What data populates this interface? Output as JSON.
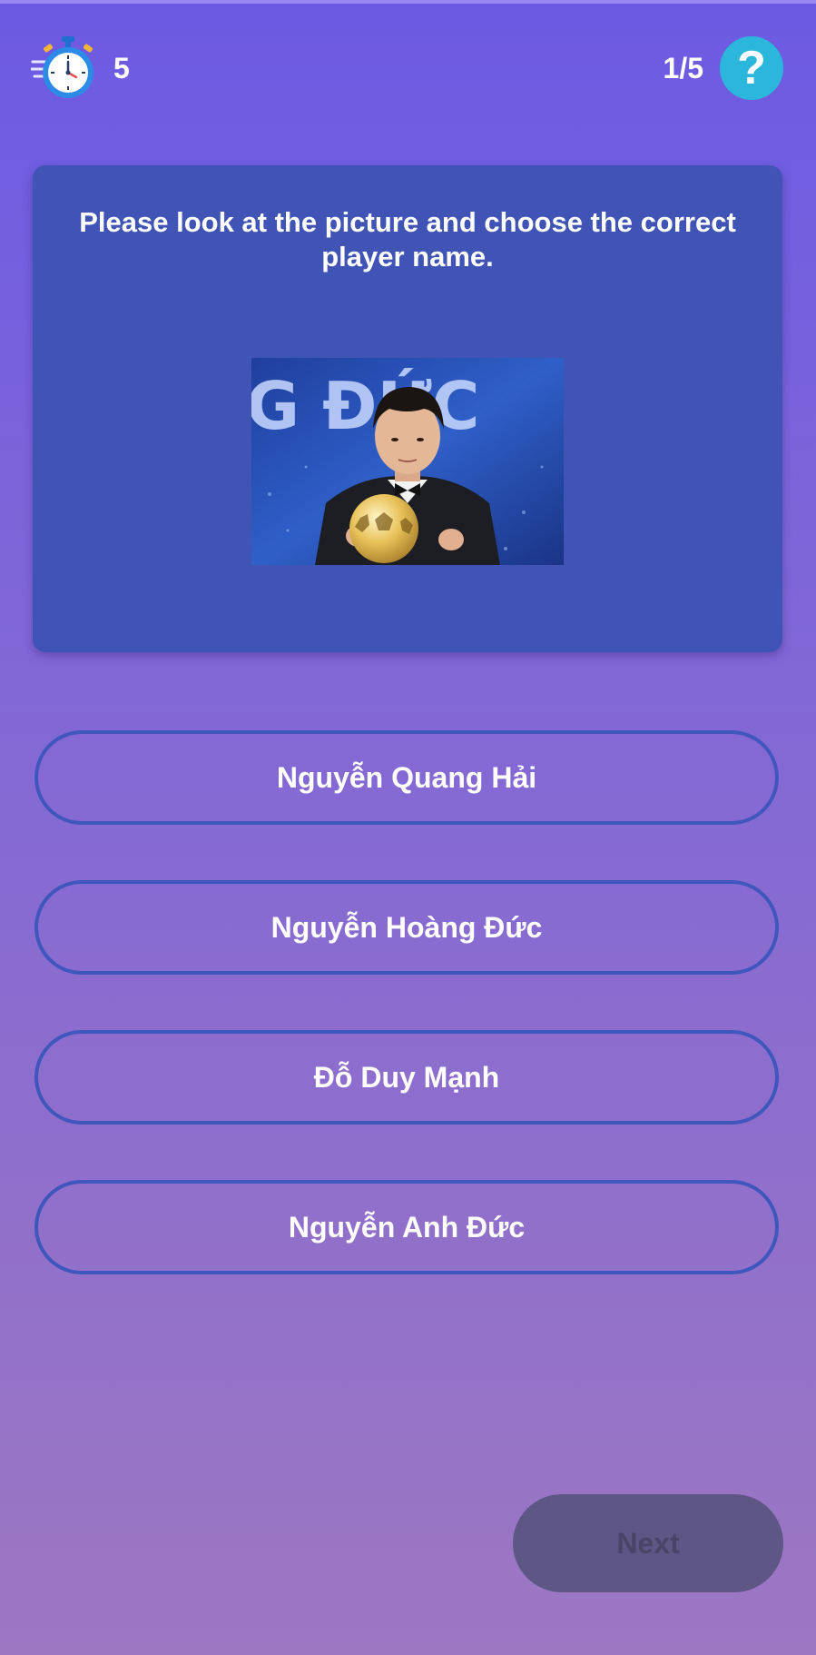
{
  "header": {
    "timer_value": "5",
    "progress": "1/5",
    "help_symbol": "?",
    "timer_icon": "stopwatch-icon",
    "help_icon": "question-mark-icon"
  },
  "question": {
    "text": "Please look at the picture and choose the correct player name.",
    "image_icon": "player-photo"
  },
  "answers": [
    {
      "label": "Nguyễn Quang Hải"
    },
    {
      "label": "Nguyễn Hoàng Đức"
    },
    {
      "label": "Đỗ Duy Mạnh"
    },
    {
      "label": "Nguyễn Anh Đức"
    }
  ],
  "footer": {
    "next_label": "Next"
  },
  "colors": {
    "background_top": "#6c5ae3",
    "background_bottom": "#9c77c2",
    "card": "#4054b6",
    "answer_border": "#3f56bd",
    "help_button": "#2bb6dc",
    "next_disabled": "#5e5786"
  }
}
